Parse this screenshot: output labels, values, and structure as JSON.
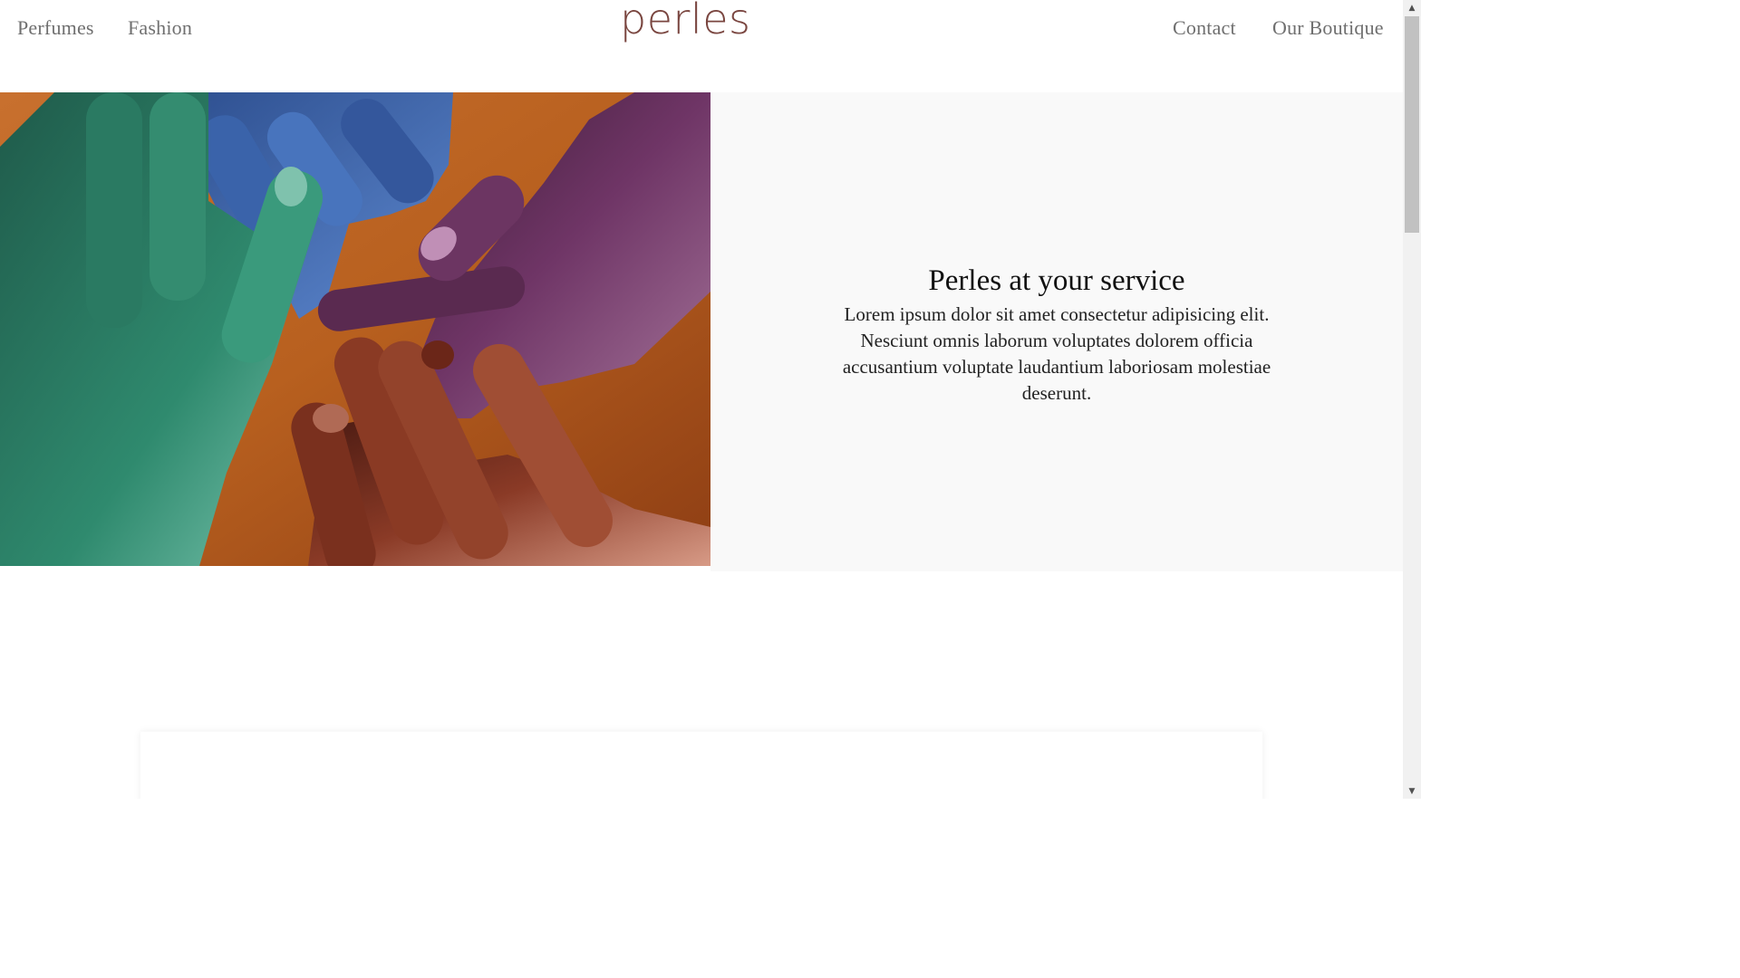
{
  "header": {
    "logo": "perles",
    "nav_left": [
      "Perfumes",
      "Fashion"
    ],
    "nav_right": [
      "Contact",
      "Our Boutique"
    ]
  },
  "hero": {
    "image_desc_icon": "painted-hands-image",
    "title": "Perles at your service",
    "text": "Lorem ipsum dolor sit amet consectetur adipisicing elit. Nesciunt omnis laborum voluptates dolorem officia accusantium voluptate laudantium laboriosam molestiae deserunt."
  },
  "colors": {
    "logo": "#7a4640",
    "nav_text": "#6f6f6f",
    "panel_bg": "#f9f9f9",
    "image_bg": "#b85c22"
  },
  "scrollbar": {
    "up_icon": "scroll-up-arrow-icon",
    "down_icon": "scroll-down-arrow-icon"
  }
}
